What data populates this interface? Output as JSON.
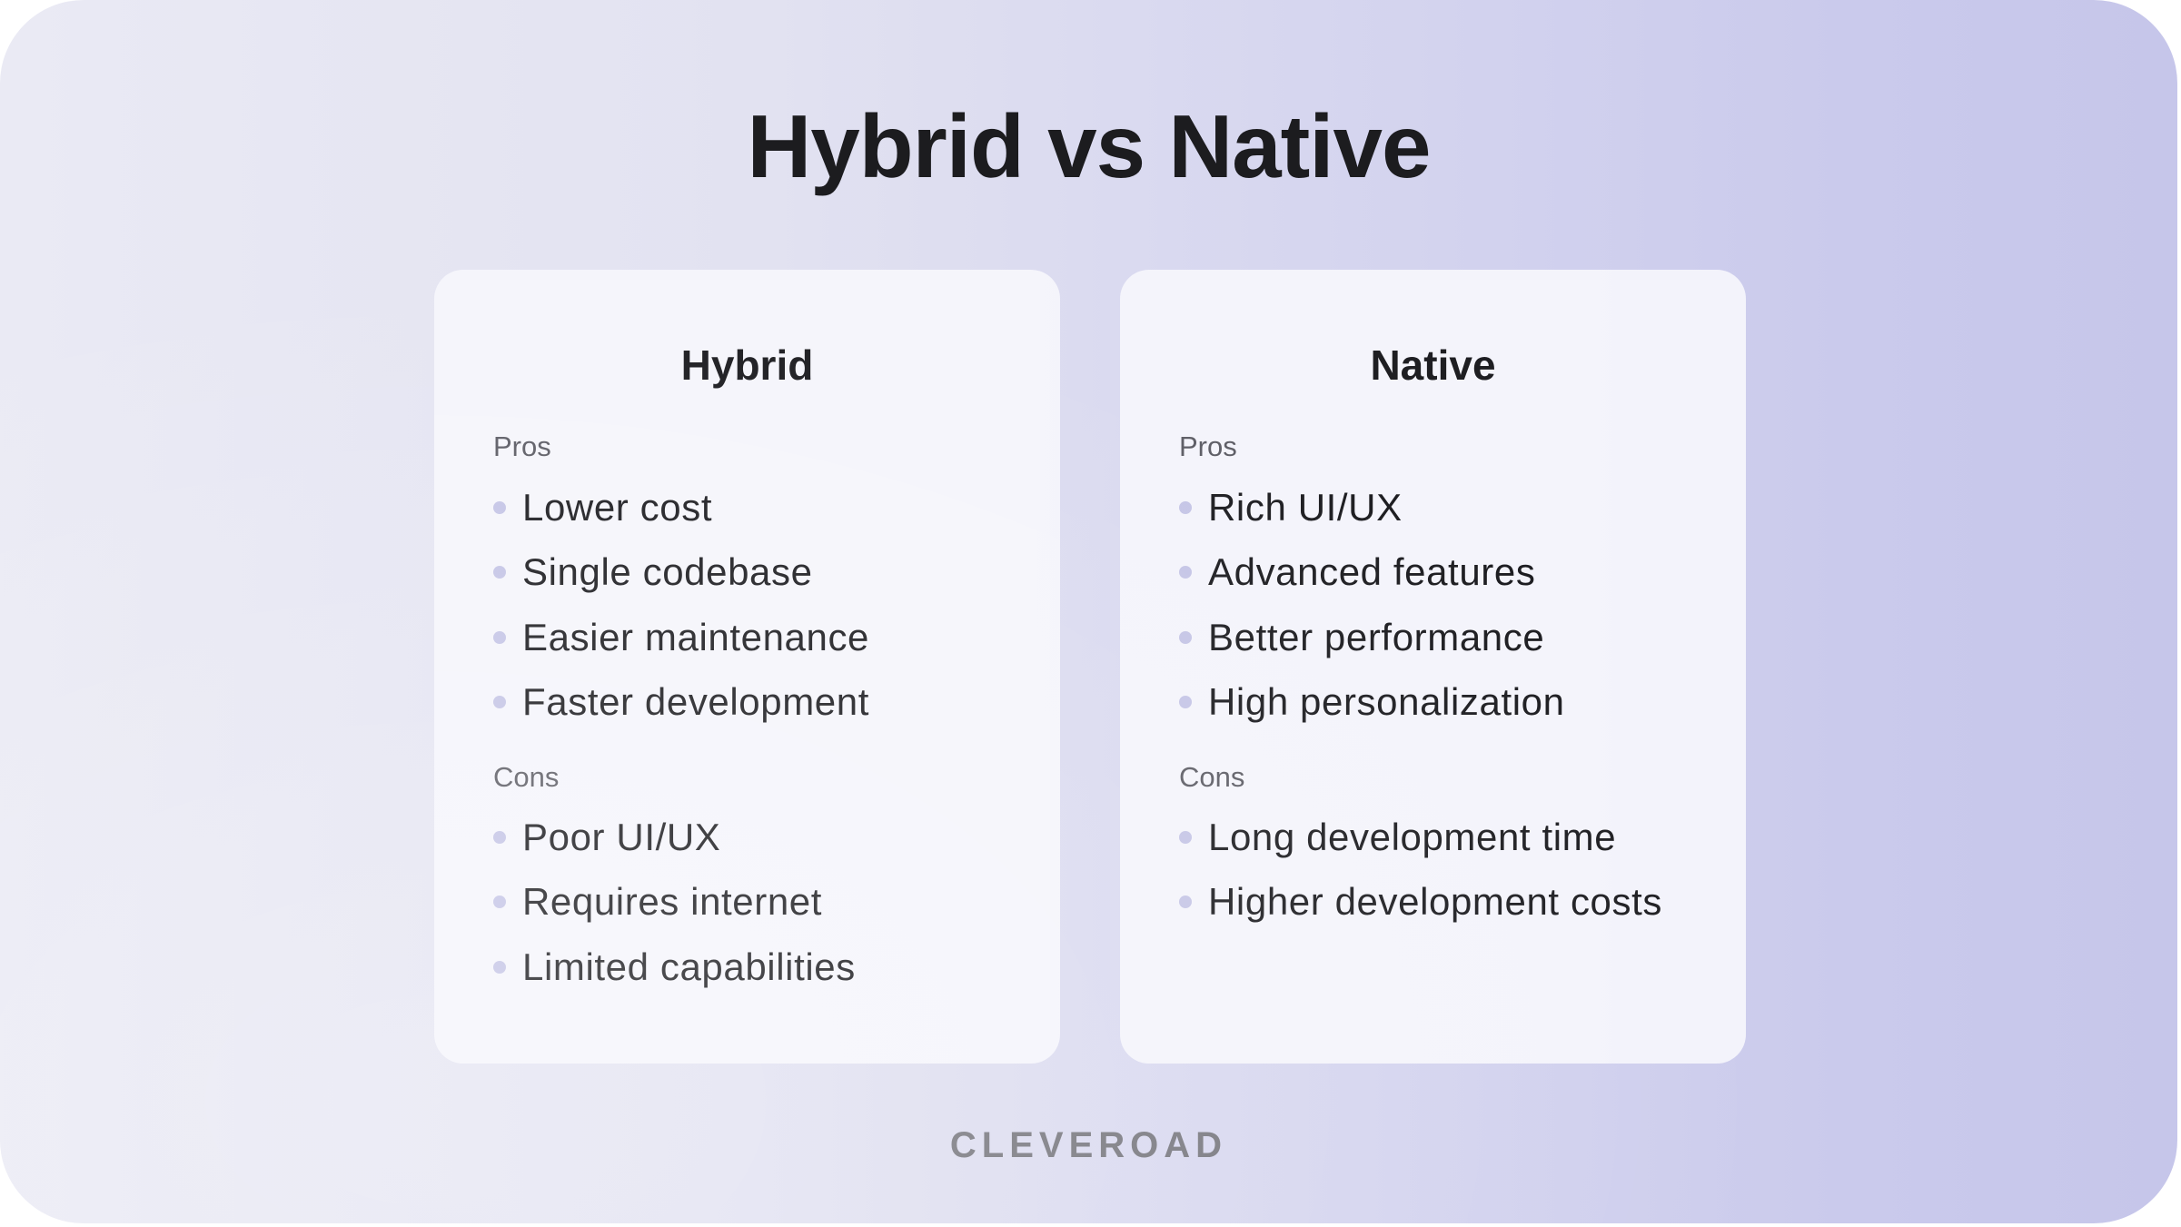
{
  "title": "Hybrid vs Native",
  "colors": {
    "bullet": "#c5c5e6",
    "text": "#1e1e22",
    "label": "#5e5e66",
    "logo": "#78787f"
  },
  "cards": [
    {
      "title": "Hybrid",
      "pros_label": "Pros",
      "pros": [
        "Lower cost",
        "Single codebase",
        "Easier maintenance",
        "Faster development"
      ],
      "cons_label": "Cons",
      "cons": [
        "Poor UI/UX",
        "Requires internet",
        "Limited capabilities"
      ]
    },
    {
      "title": "Native",
      "pros_label": "Pros",
      "pros": [
        "Rich UI/UX",
        "Advanced features",
        "Better performance",
        "High personalization"
      ],
      "cons_label": "Cons",
      "cons": [
        "Long development time",
        "Higher development costs"
      ]
    }
  ],
  "logo": "CLEVEROAD"
}
